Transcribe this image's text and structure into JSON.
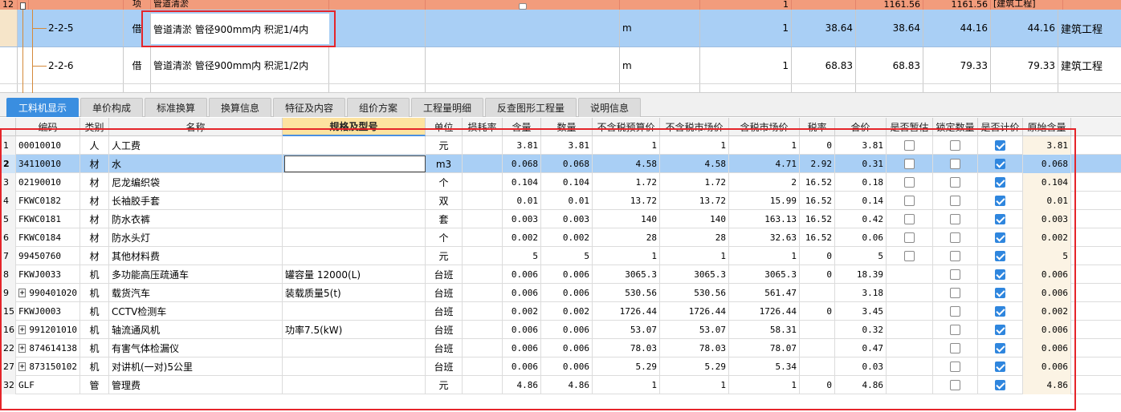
{
  "top_rows": {
    "r12": {
      "num": "12",
      "kind": "项",
      "name": "管道清淤",
      "qty": "1",
      "v1": "1161.56",
      "v2": "1161.56",
      "dept": "[建筑工程]"
    },
    "r225": {
      "code": "2-2-5",
      "kind": "借",
      "name": "管道清淤 管径900mm内 积泥1/4内",
      "unit": "m",
      "qty": "1",
      "p1": "38.64",
      "p2": "38.64",
      "p3": "44.16",
      "p4": "44.16",
      "dept": "建筑工程"
    },
    "r226": {
      "code": "2-2-6",
      "kind": "借",
      "name": "管道清淤 管径900mm内 积泥1/2内",
      "unit": "m",
      "qty": "1",
      "p1": "68.83",
      "p2": "68.83",
      "p3": "79.33",
      "p4": "79.33",
      "dept": "建筑工程"
    }
  },
  "tabs": [
    "工料机显示",
    "单价构成",
    "标准换算",
    "换算信息",
    "特征及内容",
    "组价方案",
    "工程量明细",
    "反查图形工程量",
    "说明信息"
  ],
  "columns": [
    "编码",
    "类别",
    "名称",
    "规格及型号",
    "单位",
    "损耗率",
    "含量",
    "数量",
    "不含税预算价",
    "不含税市场价",
    "含税市场价",
    "税率",
    "合价",
    "是否暂估",
    "锁定数量",
    "是否计价",
    "原始含量"
  ],
  "rows": [
    {
      "idx": "1",
      "code": "00010010",
      "expand": false,
      "cat": "人",
      "name": "人工费",
      "spec": "",
      "unit": "元",
      "loss": "",
      "content": "3.81",
      "qty": "3.81",
      "p_budget": "1",
      "p_market": "1",
      "p_tax": "1",
      "rate": "0",
      "total": "3.81",
      "est": true,
      "lock": false,
      "priced": true,
      "orig": "3.81"
    },
    {
      "idx": "2",
      "code": "34110010",
      "expand": false,
      "cat": "材",
      "name": "水",
      "spec": "",
      "unit": "m3",
      "loss": "",
      "content": "0.068",
      "qty": "0.068",
      "p_budget": "4.58",
      "p_market": "4.58",
      "p_tax": "4.71",
      "rate": "2.92",
      "total": "0.31",
      "est": true,
      "lock": false,
      "priced": true,
      "orig": "0.068"
    },
    {
      "idx": "3",
      "code": "02190010",
      "expand": false,
      "cat": "材",
      "name": "尼龙编织袋",
      "spec": "",
      "unit": "个",
      "loss": "",
      "content": "0.104",
      "qty": "0.104",
      "p_budget": "1.72",
      "p_market": "1.72",
      "p_tax": "2",
      "rate": "16.52",
      "total": "0.18",
      "est": true,
      "lock": false,
      "priced": true,
      "orig": "0.104"
    },
    {
      "idx": "4",
      "code": "FKWC0182",
      "expand": false,
      "cat": "材",
      "name": "长袖胶手套",
      "spec": "",
      "unit": "双",
      "loss": "",
      "content": "0.01",
      "qty": "0.01",
      "p_budget": "13.72",
      "p_market": "13.72",
      "p_tax": "15.99",
      "rate": "16.52",
      "total": "0.14",
      "est": true,
      "lock": false,
      "priced": true,
      "orig": "0.01"
    },
    {
      "idx": "5",
      "code": "FKWC0181",
      "expand": false,
      "cat": "材",
      "name": "防水衣裤",
      "spec": "",
      "unit": "套",
      "loss": "",
      "content": "0.003",
      "qty": "0.003",
      "p_budget": "140",
      "p_market": "140",
      "p_tax": "163.13",
      "rate": "16.52",
      "total": "0.42",
      "est": true,
      "lock": false,
      "priced": true,
      "orig": "0.003"
    },
    {
      "idx": "6",
      "code": "FKWC0184",
      "expand": false,
      "cat": "材",
      "name": "防水头灯",
      "spec": "",
      "unit": "个",
      "loss": "",
      "content": "0.002",
      "qty": "0.002",
      "p_budget": "28",
      "p_market": "28",
      "p_tax": "32.63",
      "rate": "16.52",
      "total": "0.06",
      "est": true,
      "lock": false,
      "priced": true,
      "orig": "0.002"
    },
    {
      "idx": "7",
      "code": "99450760",
      "expand": false,
      "cat": "材",
      "name": "其他材料费",
      "spec": "",
      "unit": "元",
      "loss": "",
      "content": "5",
      "qty": "5",
      "p_budget": "1",
      "p_market": "1",
      "p_tax": "1",
      "rate": "0",
      "total": "5",
      "est": true,
      "lock": false,
      "priced": true,
      "orig": "5"
    },
    {
      "idx": "8",
      "code": "FKWJ0033",
      "expand": false,
      "cat": "机",
      "name": "多功能高压疏通车",
      "spec": "罐容量 12000(L)",
      "unit": "台班",
      "loss": "",
      "content": "0.006",
      "qty": "0.006",
      "p_budget": "3065.3",
      "p_market": "3065.3",
      "p_tax": "3065.3",
      "rate": "0",
      "total": "18.39",
      "est": null,
      "lock": false,
      "priced": true,
      "orig": "0.006"
    },
    {
      "idx": "9",
      "code": "990401020",
      "expand": true,
      "cat": "机",
      "name": "载货汽车",
      "spec": "装载质量5(t)",
      "unit": "台班",
      "loss": "",
      "content": "0.006",
      "qty": "0.006",
      "p_budget": "530.56",
      "p_market": "530.56",
      "p_tax": "561.47",
      "rate": "",
      "total": "3.18",
      "est": null,
      "lock": false,
      "priced": true,
      "orig": "0.006"
    },
    {
      "idx": "15",
      "code": "FKWJ0003",
      "expand": false,
      "cat": "机",
      "name": "CCTV检测车",
      "spec": "",
      "unit": "台班",
      "loss": "",
      "content": "0.002",
      "qty": "0.002",
      "p_budget": "1726.44",
      "p_market": "1726.44",
      "p_tax": "1726.44",
      "rate": "0",
      "total": "3.45",
      "est": null,
      "lock": false,
      "priced": true,
      "orig": "0.002"
    },
    {
      "idx": "16",
      "code": "991201010",
      "expand": true,
      "cat": "机",
      "name": "轴流通风机",
      "spec": "功率7.5(kW)",
      "unit": "台班",
      "loss": "",
      "content": "0.006",
      "qty": "0.006",
      "p_budget": "53.07",
      "p_market": "53.07",
      "p_tax": "58.31",
      "rate": "",
      "total": "0.32",
      "est": null,
      "lock": false,
      "priced": true,
      "orig": "0.006"
    },
    {
      "idx": "22",
      "code": "874614138",
      "expand": true,
      "cat": "机",
      "name": "有害气体检漏仪",
      "spec": "",
      "unit": "台班",
      "loss": "",
      "content": "0.006",
      "qty": "0.006",
      "p_budget": "78.03",
      "p_market": "78.03",
      "p_tax": "78.07",
      "rate": "",
      "total": "0.47",
      "est": null,
      "lock": false,
      "priced": true,
      "orig": "0.006"
    },
    {
      "idx": "27",
      "code": "873150102",
      "expand": true,
      "cat": "机",
      "name": "对讲机(一对)5公里",
      "spec": "",
      "unit": "台班",
      "loss": "",
      "content": "0.006",
      "qty": "0.006",
      "p_budget": "5.29",
      "p_market": "5.29",
      "p_tax": "5.34",
      "rate": "",
      "total": "0.03",
      "est": null,
      "lock": false,
      "priced": true,
      "orig": "0.006"
    },
    {
      "idx": "32",
      "code": "GLF",
      "expand": false,
      "cat": "管",
      "name": "管理费",
      "spec": "",
      "unit": "元",
      "loss": "",
      "content": "4.86",
      "qty": "4.86",
      "p_budget": "1",
      "p_market": "1",
      "p_tax": "1",
      "rate": "0",
      "total": "4.86",
      "est": null,
      "lock": false,
      "priced": true,
      "orig": "4.86"
    }
  ],
  "colors": {
    "accent": "#3a8ee0",
    "selection": "#a9cff5",
    "highlight_box": "#e5252a",
    "parent_row": "#f29c7c"
  }
}
